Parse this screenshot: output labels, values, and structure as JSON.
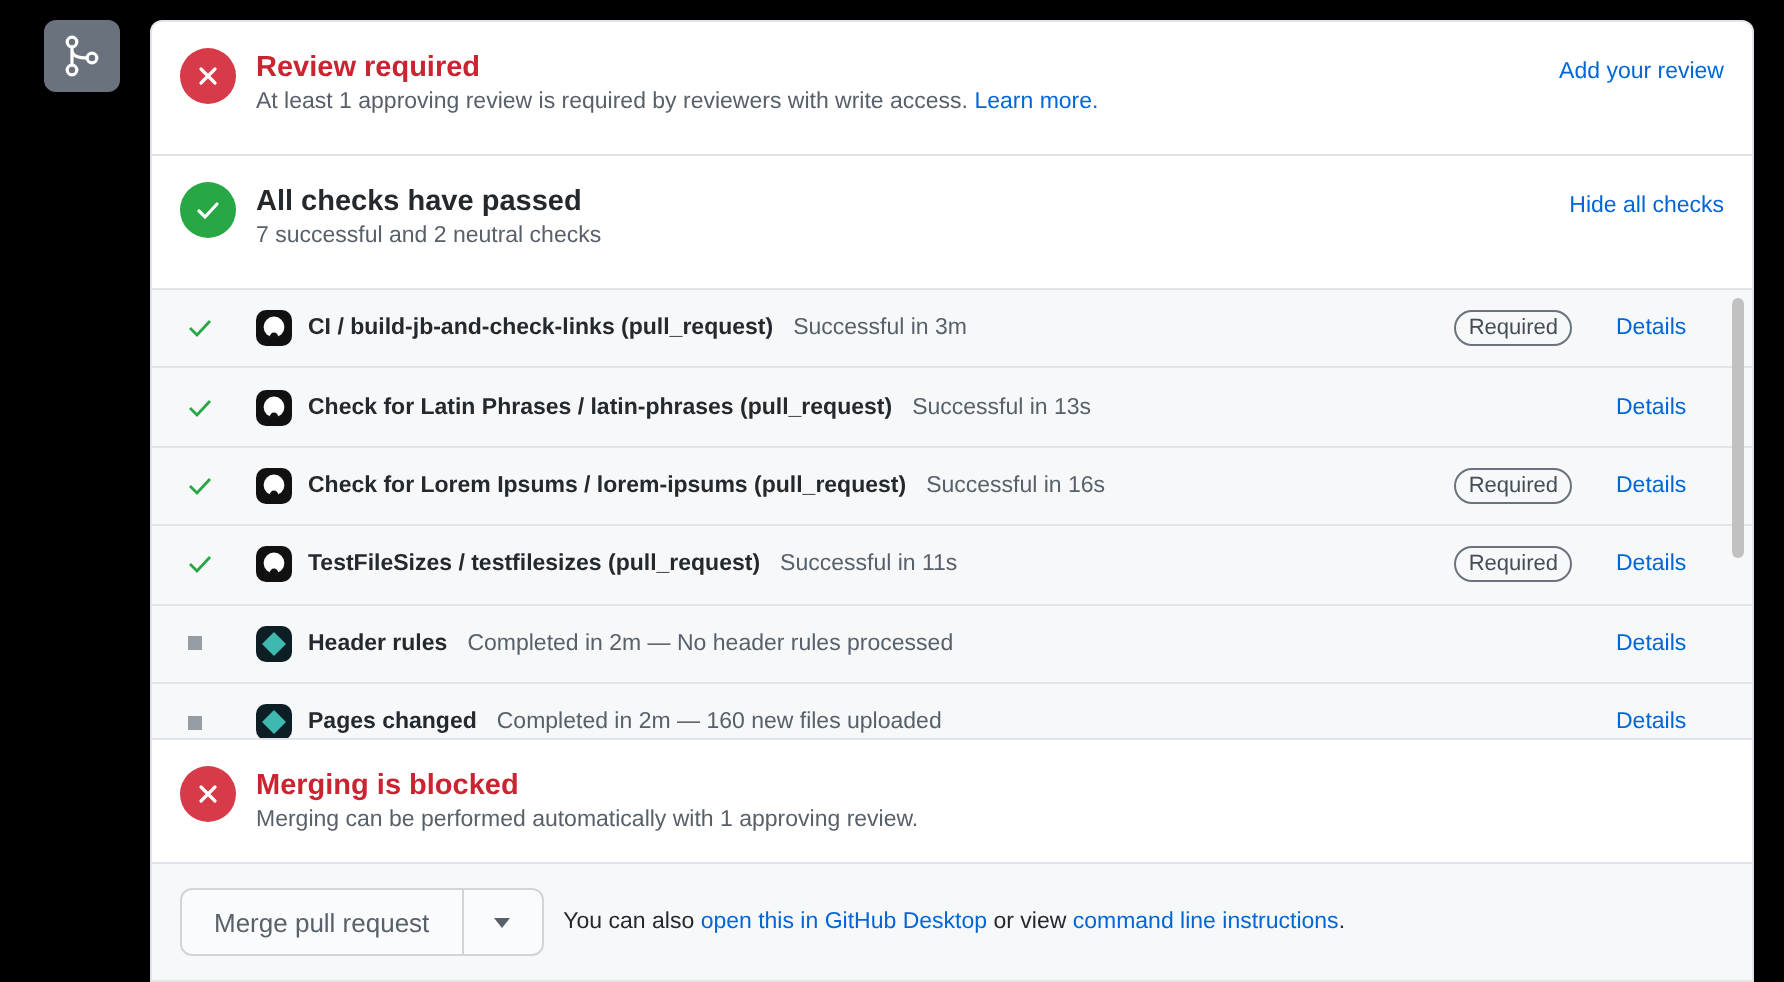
{
  "review": {
    "kind": "failure",
    "title": "Review required",
    "text": "At least 1 approving review is required by reviewers with write access.",
    "link": "Learn more.",
    "action": "Add your review"
  },
  "checks_summary": {
    "kind": "success",
    "title": "All checks have passed",
    "subtitle": "7 successful and 2 neutral checks",
    "action": "Hide all checks"
  },
  "checks": [
    {
      "kind": "success",
      "name": "CI / build-jb-and-check-links (pull_request)",
      "result": "Successful in 3m",
      "badge": "Required",
      "link": "Details"
    },
    {
      "kind": "success",
      "name": "Check for Latin Phrases / latin-phrases (pull_request)",
      "result": "Successful in 13s",
      "link": "Details"
    },
    {
      "kind": "success",
      "name": "Check for Lorem Ipsums / lorem-ipsums (pull_request)",
      "result": "Successful in 16s",
      "badge": "Required",
      "link": "Details"
    },
    {
      "kind": "success",
      "name": "TestFileSizes / testfilesizes (pull_request)",
      "result": "Successful in 11s",
      "badge": "Required",
      "link": "Details"
    },
    {
      "kind": "neutral",
      "name": "Header rules",
      "result": "Completed in 2m — No header rules processed",
      "link": "Details"
    },
    {
      "kind": "neutral",
      "name": "Pages changed",
      "result": "Completed in 2m — 160 new files uploaded",
      "link": "Details"
    }
  ],
  "merge_status": {
    "kind": "failure",
    "title": "Merging is blocked",
    "text": "Merging can be performed automatically with 1 approving review."
  },
  "merge_bar": {
    "button": "Merge pull request",
    "hint_before": "You can also",
    "link_1": "open this in GitHub Desktop",
    "hint_middle": "or view",
    "link_2": "command line instructions",
    "hint_after": "."
  }
}
